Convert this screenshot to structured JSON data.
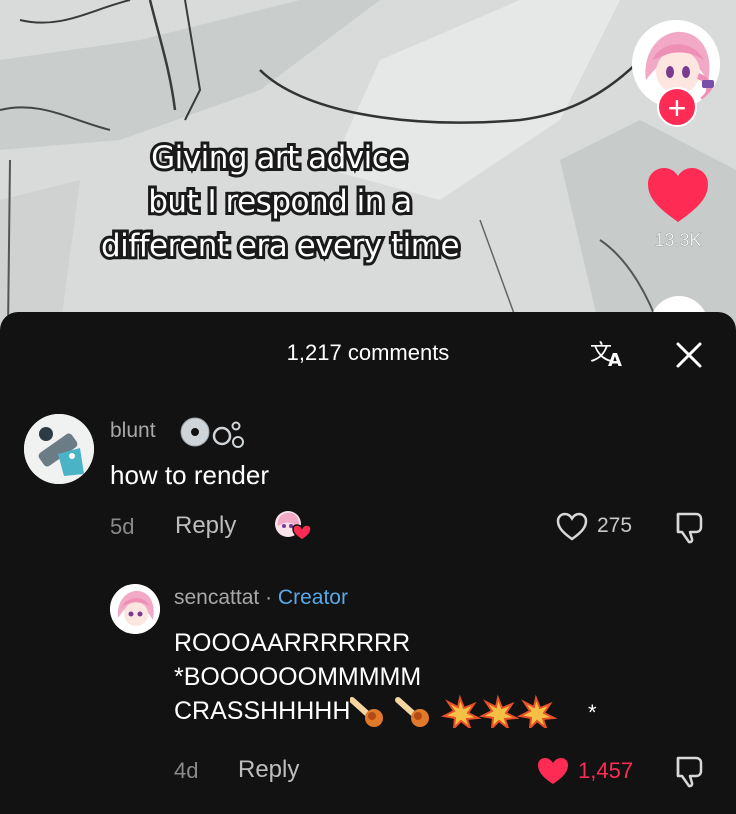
{
  "video": {
    "caption_lines": [
      "Giving art advice",
      "but I respond in a",
      "different era every time"
    ],
    "like_count": "13.3K",
    "follow_icon": "plus-icon"
  },
  "sheet": {
    "title": "1,217 comments",
    "translate_icon": "translate-icon",
    "close_icon": "close-icon"
  },
  "comments": [
    {
      "username": "blunt",
      "badge_icons": "cd-disc-icon bubbles-icon",
      "text": "how to render",
      "age": "5d",
      "reply_label": "Reply",
      "likes": "275",
      "liked": false
    }
  ],
  "reply": {
    "username": "sencattat",
    "separator": "·",
    "creator_label": "Creator",
    "text_lines": [
      "ROOOAARRRRRRR",
      "*BOOOOOOMMMMM",
      "CRASSHHHHH"
    ],
    "trailing": "*",
    "age": "4d",
    "reply_label": "Reply",
    "likes": "1,457",
    "liked": true
  },
  "colors": {
    "accent": "#fe2c55",
    "creator": "#58a9e8",
    "sheet_bg": "#121212"
  }
}
